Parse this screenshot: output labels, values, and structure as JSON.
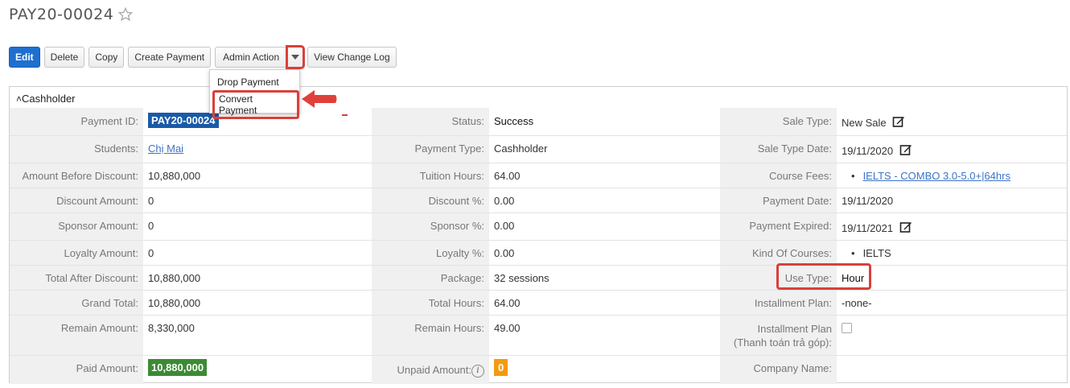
{
  "header": {
    "title": "PAY20-00024",
    "star_icon": "star-icon"
  },
  "toolbar": {
    "edit": "Edit",
    "delete": "Delete",
    "copy": "Copy",
    "create_payment": "Create Payment",
    "admin_action": "Admin Action",
    "view_change_log": "View Change Log"
  },
  "dropdown": {
    "items": [
      "Drop Payment",
      "Convert Payment"
    ]
  },
  "panel": {
    "title": "Cashholder"
  },
  "rows": [
    {
      "c1l": "Payment ID:",
      "c1v": "PAY20-00024",
      "c2l": "Status:",
      "c2v": "Success",
      "c3l": "Sale Type:",
      "c3v": "New Sale"
    },
    {
      "c1l": "Students:",
      "c1v": "Chị Mai",
      "c2l": "Payment Type:",
      "c2v": "Cashholder",
      "c3l": "Sale Type Date:",
      "c3v": "19/11/2020"
    },
    {
      "c1l": "Amount Before Discount:",
      "c1v": "10,880,000",
      "c2l": "Tuition Hours:",
      "c2v": "64.00",
      "c3l": "Course Fees:",
      "c3v": "IELTS - COMBO 3.0-5.0+|64hrs"
    },
    {
      "c1l": "Discount Amount:",
      "c1v": "0",
      "c2l": "Discount %:",
      "c2v": "0.00",
      "c3l": "Payment Date:",
      "c3v": "19/11/2020"
    },
    {
      "c1l": "Sponsor Amount:",
      "c1v": "0",
      "c2l": "Sponsor %:",
      "c2v": "0.00",
      "c3l": "Payment Expired:",
      "c3v": "19/11/2021"
    },
    {
      "c1l": "Loyalty Amount:",
      "c1v": "0",
      "c2l": "Loyalty %:",
      "c2v": "0.00",
      "c3l": "Kind Of Courses:",
      "c3v": "IELTS"
    },
    {
      "c1l": "Total After Discount:",
      "c1v": "10,880,000",
      "c2l": "Package:",
      "c2v": "32 sessions",
      "c3l": "Use Type:",
      "c3v": "Hour"
    },
    {
      "c1l": "Grand Total:",
      "c1v": "10,880,000",
      "c2l": "Total Hours:",
      "c2v": "64.00",
      "c3l": "Installment Plan:",
      "c3v": "-none-"
    },
    {
      "c1l": "Remain Amount:",
      "c1v": "8,330,000",
      "c2l": "Remain Hours:",
      "c2v": "49.00",
      "c3l": "Installment Plan",
      "c3l2": "(Thanh toán trả góp):",
      "c3v": ""
    },
    {
      "c1l": "Paid Amount:",
      "c1v": "10,880,000",
      "c2l": "Unpaid Amount:",
      "c2v": "0",
      "c3l": "Company Name:",
      "c3v": ""
    }
  ]
}
